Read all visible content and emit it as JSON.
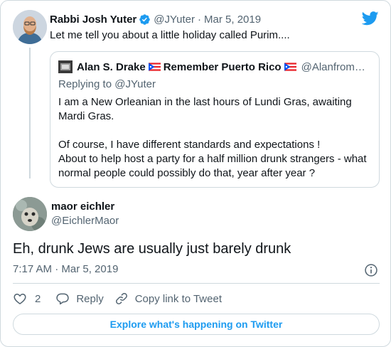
{
  "parent_tweet": {
    "author_name": "Rabbi Josh Yuter",
    "handle": "@JYuter",
    "date": "Mar 5, 2019",
    "text": "Let me tell you about a little holiday called Purim....",
    "avatar_icon": "person-avatar",
    "verified_icon": "verified-badge-icon"
  },
  "quoted_tweet": {
    "author_name": "Alan S. Drake",
    "display_suffix": "Remember Puerto Rico",
    "handle": "@Alanfrom…",
    "replying_to": "Replying to @JYuter",
    "body_line1": "I am a New Orleanian in the last hours of Lundi Gras, awaiting Mardi Gras.",
    "body_line2": "Of course, I have different standards and expectations !",
    "body_line3": "About to help host a party for a half million drunk strangers - what normal people could  possibly do that, year after year ?",
    "flag_icon": "puerto-rico-flag"
  },
  "main_tweet": {
    "author_name": "maor eichler",
    "handle": "@EichlerMaor",
    "text": "Eh, drunk Jews are usually just barely drunk",
    "timestamp": "7:17 AM · Mar 5, 2019"
  },
  "actions": {
    "like_count": "2",
    "reply_label": "Reply",
    "copy_link_label": "Copy link to Tweet"
  },
  "footer": {
    "explore_label": "Explore what's happening on Twitter"
  },
  "colors": {
    "accent": "#1d9bf0",
    "text": "#0f1419",
    "muted": "#536471",
    "border": "#cfd9de"
  }
}
